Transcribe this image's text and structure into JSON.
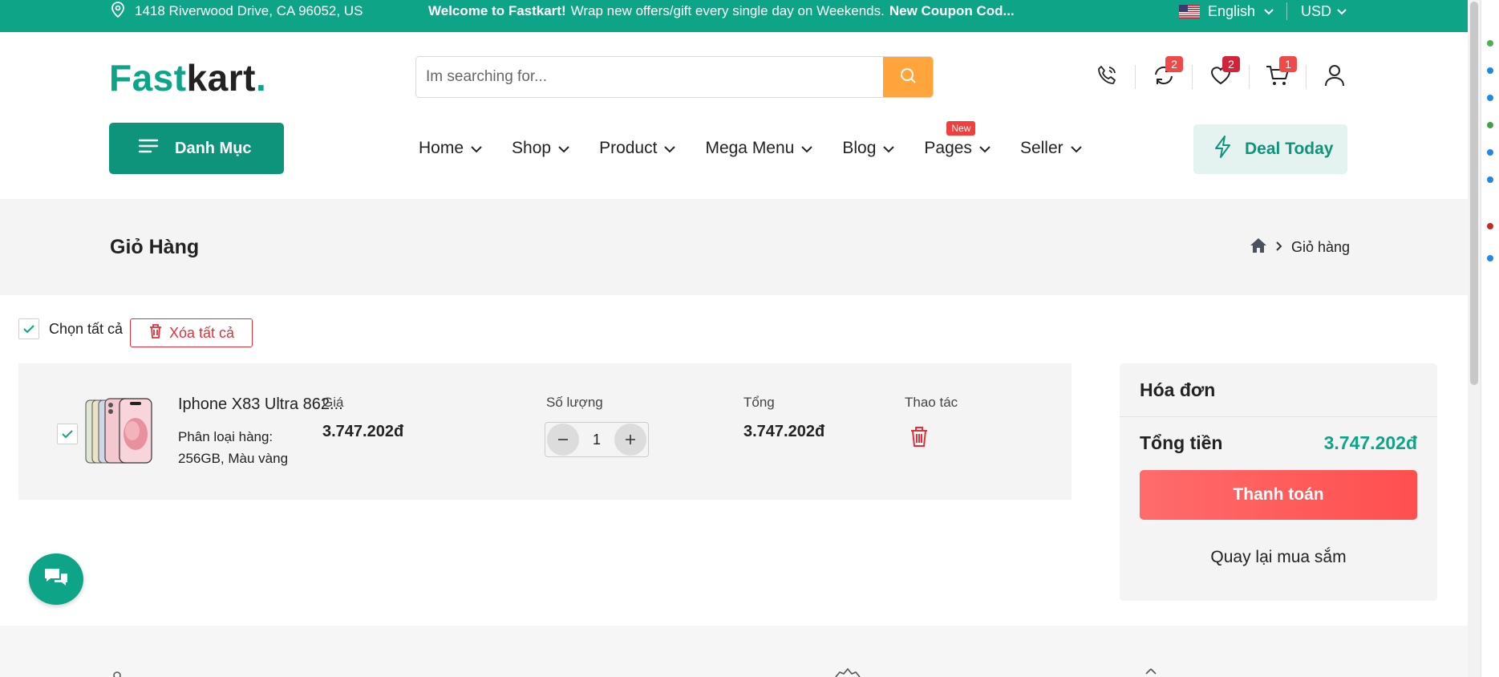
{
  "topbar": {
    "address": "1418 Riverwood Drive, CA 96052, US",
    "welcome_bold": "Welcome to Fastkart!",
    "welcome_text": "Wrap new offers/gift every single day on Weekends.",
    "coupon_text": "New Coupon Cod...",
    "language": "English",
    "currency": "USD"
  },
  "header": {
    "logo_part1": "Fast",
    "logo_part2": "kart",
    "logo_dot": ".",
    "search_placeholder": "Im searching for...",
    "compare_count": "2",
    "wishlist_count": "2",
    "cart_count": "1"
  },
  "nav": {
    "category_label": "Danh Mục",
    "items": [
      {
        "label": "Home"
      },
      {
        "label": "Shop"
      },
      {
        "label": "Product"
      },
      {
        "label": "Mega Menu"
      },
      {
        "label": "Blog"
      },
      {
        "label": "Pages",
        "badge": "New"
      },
      {
        "label": "Seller"
      }
    ],
    "deal_label": "Deal Today"
  },
  "breadcrumb": {
    "title": "Giỏ Hàng",
    "current": "Giỏ hàng"
  },
  "cart": {
    "select_all_label": "Chọn tất cả",
    "delete_all_label": "Xóa tất cả",
    "columns": {
      "price": "Giá",
      "quantity": "Số lượng",
      "total": "Tổng",
      "action": "Thao tác"
    },
    "items": [
      {
        "name": "Iphone X83 Ultra 862...",
        "variant_label": "Phân loại hàng:",
        "variant_value": "256GB, Màu vàng",
        "price": "3.747.202đ",
        "quantity": "1",
        "total": "3.747.202đ"
      }
    ]
  },
  "summary": {
    "title": "Hóa đơn",
    "total_label": "Tổng tiền",
    "total_value": "3.747.202đ",
    "checkout_label": "Thanh toán",
    "back_label": "Quay lại mua sắm"
  },
  "colors": {
    "brand": "#0da487",
    "accent": "#ffa53b",
    "danger": "#e0303a"
  }
}
